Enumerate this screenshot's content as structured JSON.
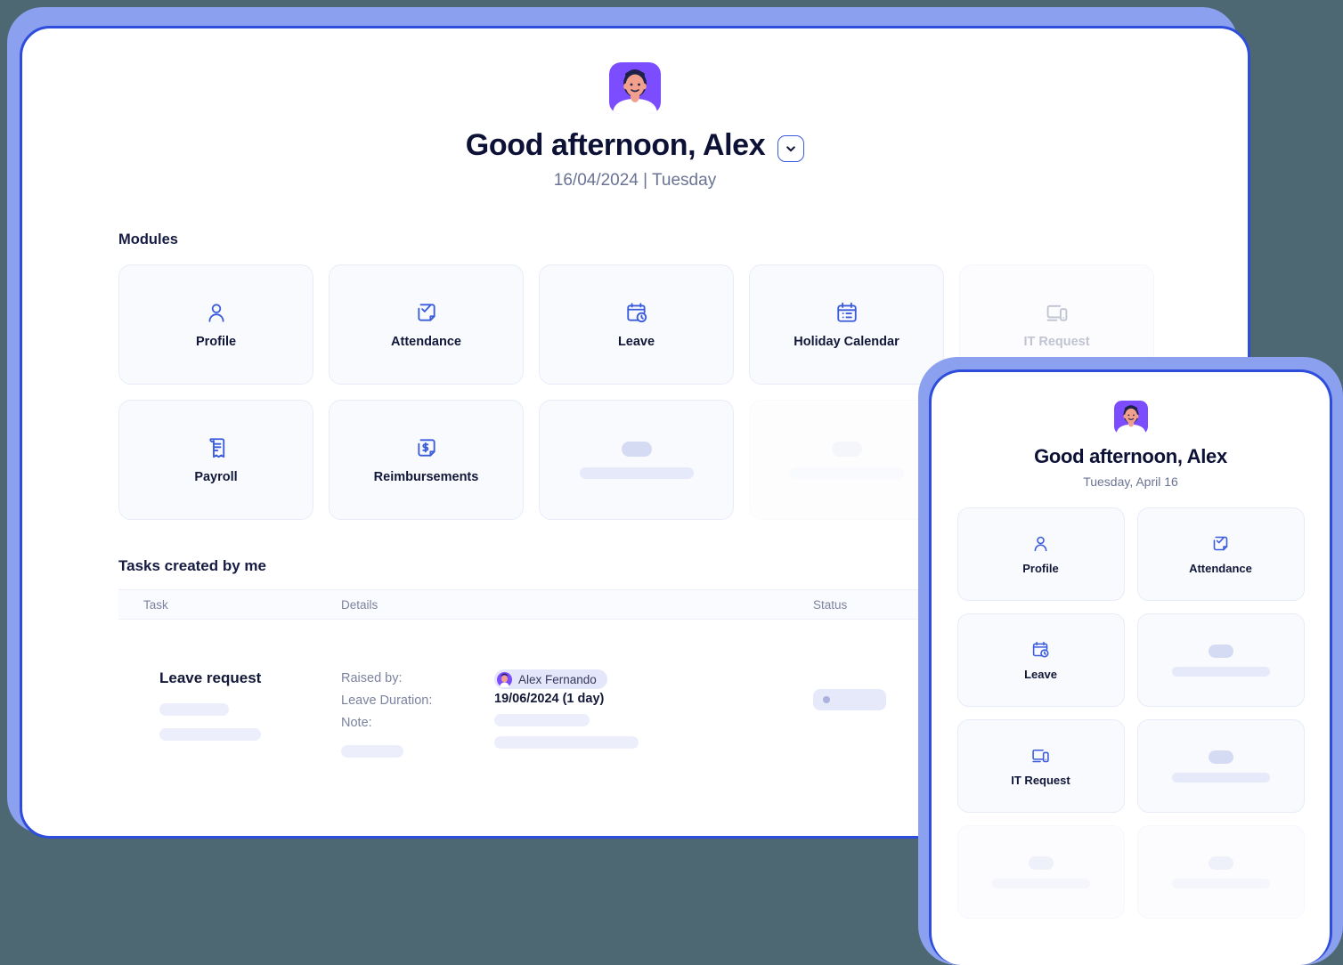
{
  "desktop": {
    "greeting": "Good afternoon, Alex",
    "date_line": "16/04/2024 | Tuesday",
    "dropdown_icon": "chevron-down-icon",
    "avatar_icon": "user-avatar-illustration",
    "modules_label": "Modules",
    "modules": [
      {
        "label": "Profile",
        "icon": "person-icon",
        "state": "active"
      },
      {
        "label": "Attendance",
        "icon": "check-document-icon",
        "state": "active"
      },
      {
        "label": "Leave",
        "icon": "calendar-clock-icon",
        "state": "active"
      },
      {
        "label": "Holiday Calendar",
        "icon": "calendar-list-icon",
        "state": "active"
      },
      {
        "label": "IT Request",
        "icon": "devices-icon",
        "state": "faded"
      },
      {
        "label": "Payroll",
        "icon": "payslip-icon",
        "state": "active"
      },
      {
        "label": "Reimbursements",
        "icon": "receipt-dollar-icon",
        "state": "active"
      },
      {
        "label": "",
        "icon": "skeleton",
        "state": "skeleton"
      },
      {
        "label": "",
        "icon": "skeleton",
        "state": "skeleton-faded"
      }
    ],
    "tasks": {
      "heading": "Tasks created by me",
      "columns": [
        "Task",
        "Details",
        "Status"
      ],
      "row": {
        "task_title": "Leave request",
        "detail_keys": [
          "Raised by:",
          "Leave Duration:",
          "Note:"
        ],
        "raised_by_name": "Alex Fernando",
        "leave_duration": "19/06/2024 (1 day)",
        "note_value": ""
      }
    }
  },
  "mobile": {
    "greeting": "Good afternoon, Alex",
    "date_line": "Tuesday, April 16",
    "avatar_icon": "user-avatar-illustration",
    "modules": [
      {
        "label": "Profile",
        "icon": "person-icon",
        "state": "active"
      },
      {
        "label": "Attendance",
        "icon": "check-document-icon",
        "state": "active"
      },
      {
        "label": "Leave",
        "icon": "calendar-clock-icon",
        "state": "active"
      },
      {
        "label": "",
        "icon": "skeleton",
        "state": "skeleton"
      },
      {
        "label": "IT Request",
        "icon": "devices-icon",
        "state": "active"
      },
      {
        "label": "",
        "icon": "skeleton",
        "state": "skeleton"
      },
      {
        "label": "",
        "icon": "skeleton",
        "state": "skeleton-faded"
      },
      {
        "label": "",
        "icon": "skeleton",
        "state": "skeleton-faded"
      }
    ]
  },
  "colors": {
    "page_background": "#4d6872",
    "frame_outer": "#8ba0ef",
    "frame_border": "#2e4ddc",
    "icon_blue": "#3a5bdb",
    "title_ink": "#0d1136",
    "muted": "#6b7394",
    "card_bg": "#f9fafd",
    "skeleton": "#e5e9fa",
    "avatar_purple": "#7c4dff"
  }
}
